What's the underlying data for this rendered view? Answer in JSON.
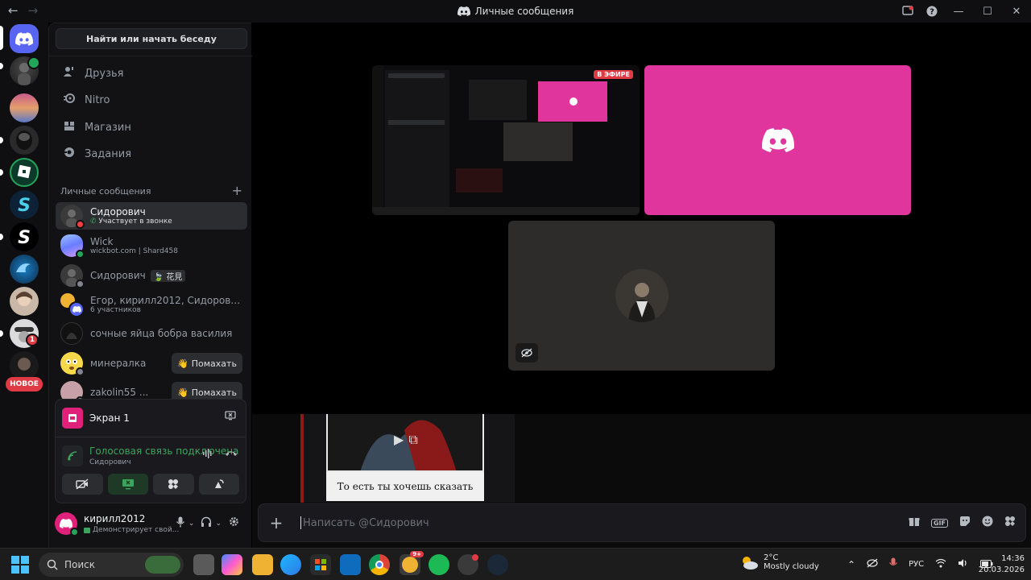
{
  "window": {
    "title": "Личные сообщения",
    "nav": {
      "back": "←",
      "forward": "→"
    }
  },
  "servers": {
    "new_badge": "НОВОЕ",
    "mention_count": "1"
  },
  "sidebar": {
    "search_button": "Найти или начать беседу",
    "nav": [
      {
        "label": "Друзья",
        "icon": "friends-icon"
      },
      {
        "label": "Nitro",
        "icon": "nitro-icon"
      },
      {
        "label": "Магазин",
        "icon": "shop-icon"
      },
      {
        "label": "Задания",
        "icon": "quests-icon"
      }
    ],
    "dm_header": "Личные сообщения",
    "dm_add": "+",
    "dms": [
      {
        "name": "Сидорович",
        "sub": "Участвует в звонке",
        "status_color": "#f23f43"
      },
      {
        "name": "Wick",
        "sub": "wickbot.com | Shard458",
        "status_color": "#23a55a"
      },
      {
        "name": "Сидорович",
        "tag": "花見",
        "sub": "",
        "status_color": "#80848e"
      },
      {
        "name": "Егор, кирилл2012, Сидорович,...",
        "sub": "6 участников",
        "status_color": ""
      },
      {
        "name": "сочные яйца бобра василия",
        "sub": "",
        "status_color": ""
      },
      {
        "name": "минералка",
        "sub": "",
        "status_color": "#80848e",
        "action": "Помахать"
      },
      {
        "name": "zakolin55 ...",
        "sub": "",
        "status_color": "#80848e",
        "action": "Помахать"
      }
    ]
  },
  "voice": {
    "screen_label": "Экран 1",
    "connected": "Голосовая связь подключена",
    "channel": "Сидорович"
  },
  "user": {
    "name": "кирилл2012",
    "status": "Демонстрирует свой..."
  },
  "call": {
    "live_badge": "В ЭФИРЕ"
  },
  "chat": {
    "gif_caption": "То есть ты хочешь сказать"
  },
  "composer": {
    "placeholder": "Написать @Сидорович",
    "gif_label": "GIF"
  },
  "taskbar": {
    "search": "Поиск",
    "weather_temp": "2°C",
    "weather_desc": "Mostly cloudy",
    "lang": "РУС",
    "time": "14:36",
    "date": "20.03.2026",
    "discord_badge": "9+"
  },
  "colors": {
    "accent": "#5865f2",
    "green": "#3ba55d",
    "pink_tile": "#e0359d",
    "live": "#e03a44"
  }
}
